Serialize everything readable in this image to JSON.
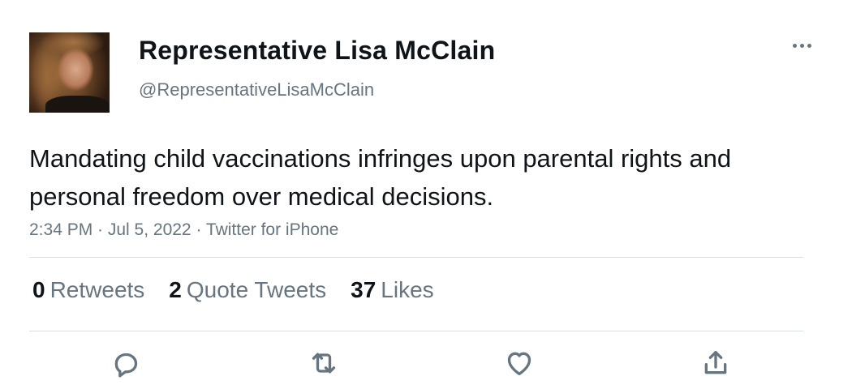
{
  "tweet": {
    "author": {
      "display_name": "Representative Lisa McClain",
      "handle": "@RepresentativeLisaMcClain"
    },
    "text": "Mandating child vaccinations infringes upon parental rights and personal freedom over medical decisions.",
    "meta": "2:34 PM · Jul 5, 2022 · Twitter for iPhone",
    "stats": {
      "retweets": {
        "count": "0",
        "label": "Retweets"
      },
      "quotes": {
        "count": "2",
        "label": "Quote Tweets"
      },
      "likes": {
        "count": "37",
        "label": "Likes"
      }
    }
  },
  "icons": {
    "more": "more-horizontal-icon",
    "reply": "reply-icon",
    "retweet": "retweet-icon",
    "like": "heart-icon",
    "share": "share-icon"
  },
  "colors": {
    "text_primary": "#0f1419",
    "text_secondary": "#66757f",
    "divider": "#d9dee2",
    "background": "#ffffff"
  }
}
